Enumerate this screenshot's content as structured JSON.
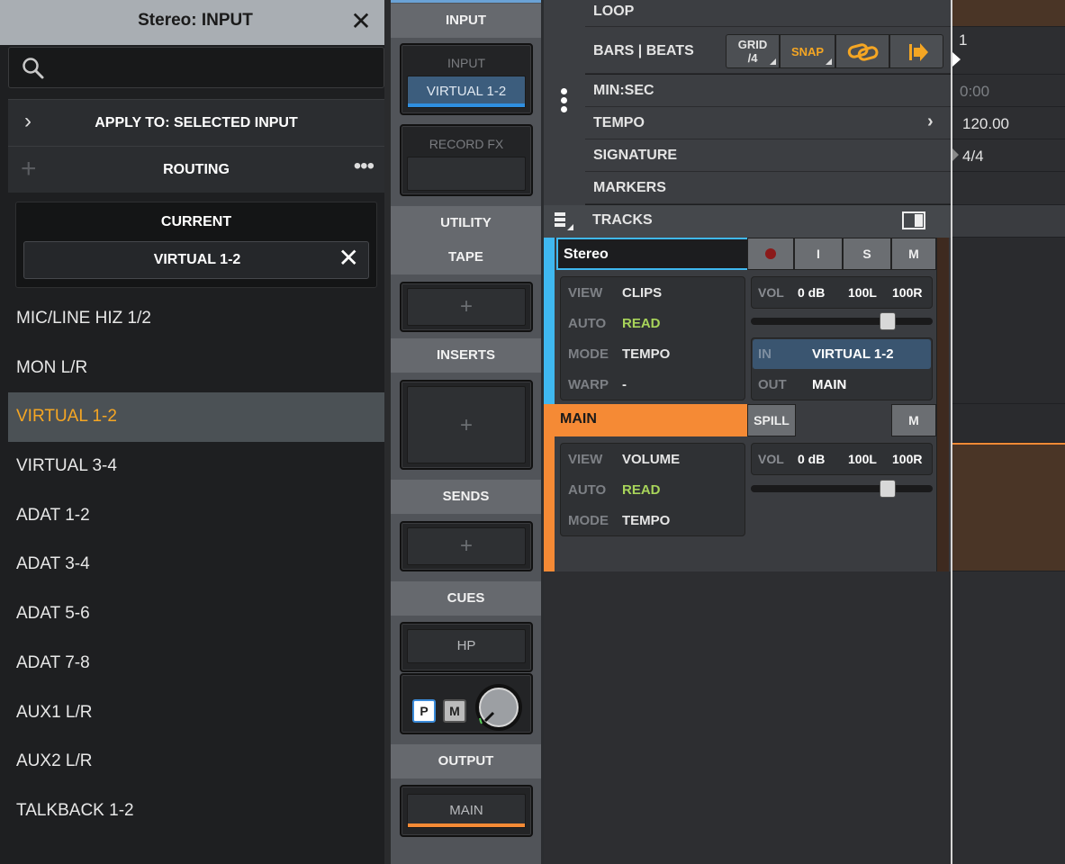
{
  "left_panel": {
    "title": "Stereo: INPUT",
    "apply_label": "APPLY TO: SELECTED INPUT",
    "routing_label": "ROUTING",
    "current_label": "CURRENT",
    "current_value": "VIRTUAL 1-2",
    "inputs": [
      {
        "label": "MIC/LINE HIZ 1/2"
      },
      {
        "label": "MON L/R"
      },
      {
        "label": "VIRTUAL 1-2",
        "selected": true
      },
      {
        "label": "VIRTUAL 3-4"
      },
      {
        "label": "ADAT 1-2"
      },
      {
        "label": "ADAT 3-4"
      },
      {
        "label": "ADAT 5-6"
      },
      {
        "label": "ADAT 7-8"
      },
      {
        "label": "AUX1 L/R"
      },
      {
        "label": "AUX2 L/R"
      },
      {
        "label": "TALKBACK 1-2"
      }
    ],
    "accent_color": "#f5a623"
  },
  "strip": {
    "input_header": "INPUT",
    "input_box_label": "INPUT",
    "input_value": "VIRTUAL 1-2",
    "record_fx_label": "RECORD FX",
    "utility_header": "UTILITY",
    "tape_header": "TAPE",
    "inserts_header": "INSERTS",
    "sends_header": "SENDS",
    "cues_header": "CUES",
    "hp_label": "HP",
    "p_label": "P",
    "m_label": "M",
    "output_header": "OUTPUT",
    "output_value": "MAIN",
    "add_symbol": "+"
  },
  "timeline": {
    "loop_label": "LOOP",
    "bars_beats_label": "BARS | BEATS",
    "grid_label": "GRID",
    "grid_value": "/4",
    "snap_label": "SNAP",
    "min_sec_label": "MIN:SEC",
    "tempo_label": "TEMPO",
    "signature_label": "SIGNATURE",
    "markers_label": "MARKERS",
    "tracks_label": "TRACKS",
    "bar_value": "1",
    "time_value": "0:00",
    "tempo_value": "120.00",
    "signature_value": "4/4"
  },
  "tracks": [
    {
      "name": "Stereo",
      "color": "#3fb8f0",
      "buttons": {
        "i": "I",
        "s": "S",
        "m": "M"
      },
      "view_label": "VIEW",
      "view_value": "CLIPS",
      "auto_label": "AUTO",
      "auto_value": "READ",
      "mode_label": "MODE",
      "mode_value": "TEMPO",
      "warp_label": "WARP",
      "warp_value": "-",
      "vol_label": "VOL",
      "vol_value": "0 dB",
      "pan_l": "100L",
      "pan_r": "100R",
      "fader_level": 0.75,
      "in_label": "IN",
      "in_value": "VIRTUAL 1-2",
      "out_label": "OUT",
      "out_value": "MAIN"
    },
    {
      "name": "MAIN",
      "color": "#f58a35",
      "spill_label": "SPILL",
      "m_label": "M",
      "view_label": "VIEW",
      "view_value": "VOLUME",
      "auto_label": "AUTO",
      "auto_value": "READ",
      "mode_label": "MODE",
      "mode_value": "TEMPO",
      "vol_label": "VOL",
      "vol_value": "0 dB",
      "pan_l": "100L",
      "pan_r": "100R",
      "fader_level": 0.75
    }
  ]
}
